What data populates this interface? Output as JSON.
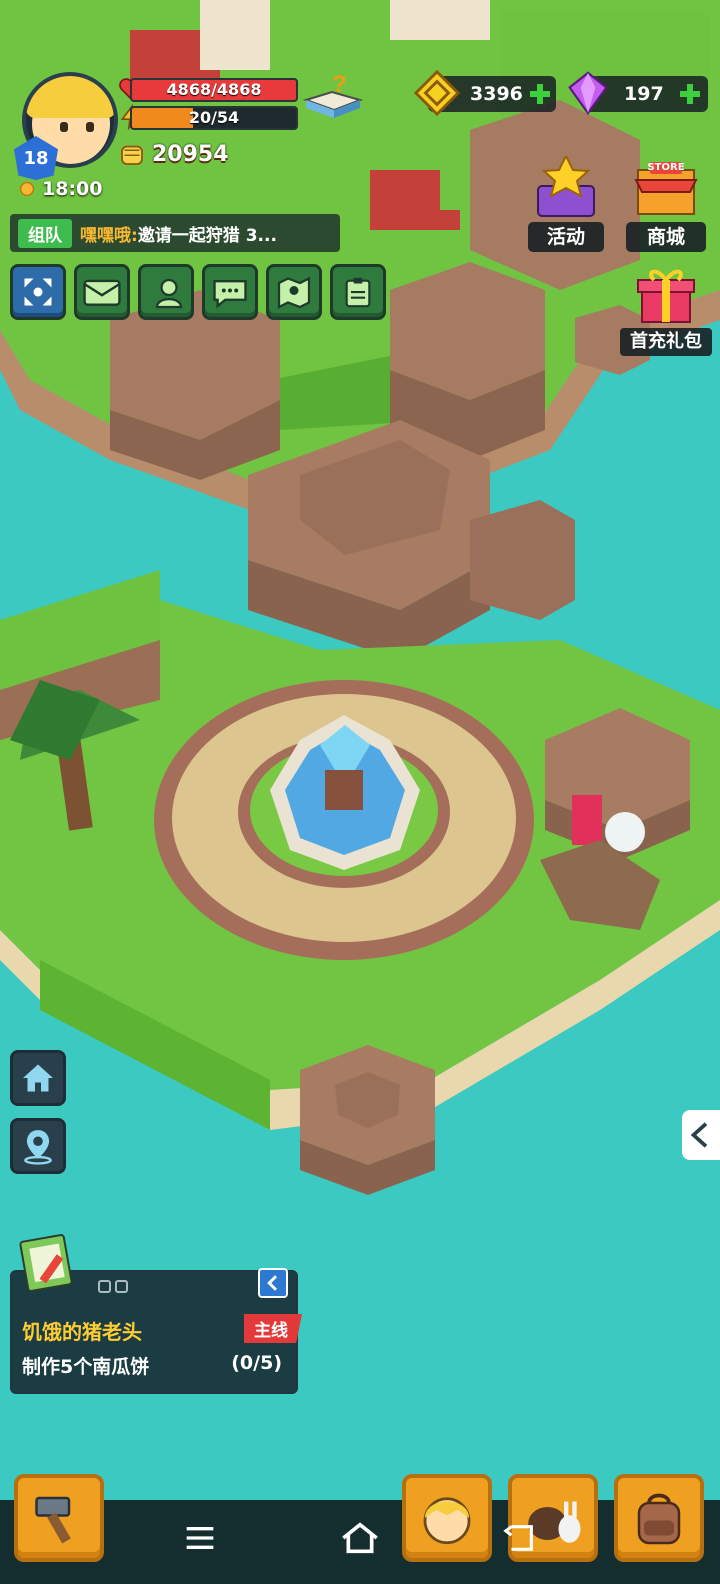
{
  "player": {
    "level": "18",
    "hp": "4868/4868",
    "hp_fraction": 1.0,
    "energy": "20/54",
    "energy_fraction": 0.37,
    "power": "20954",
    "time": "18:00"
  },
  "chat": {
    "tag": "组队",
    "user": "嘿嘿哦:",
    "message": " 邀请一起狩猎 3..."
  },
  "hud_buttons": [
    "fullscreen-icon",
    "mail-icon",
    "friends-icon",
    "chat-icon",
    "map-icon",
    "quest-log-icon"
  ],
  "currency": {
    "gold": "3396",
    "gems": "197"
  },
  "features": {
    "event_label": "活动",
    "store_label": "商城",
    "store_sign": "STORE",
    "first_charge_label": "首充礼包"
  },
  "quest": {
    "title": "饥饿的猪老头",
    "tag": "主线",
    "description": "制作5个南瓜饼",
    "progress": "(0/5)"
  },
  "colors": {
    "water": "#3cc9c2",
    "grass": "#6fc43c",
    "rock": "#a77a62",
    "hp": "#e83a3a",
    "energy": "#f08a1c",
    "accent": "#f0a020"
  }
}
